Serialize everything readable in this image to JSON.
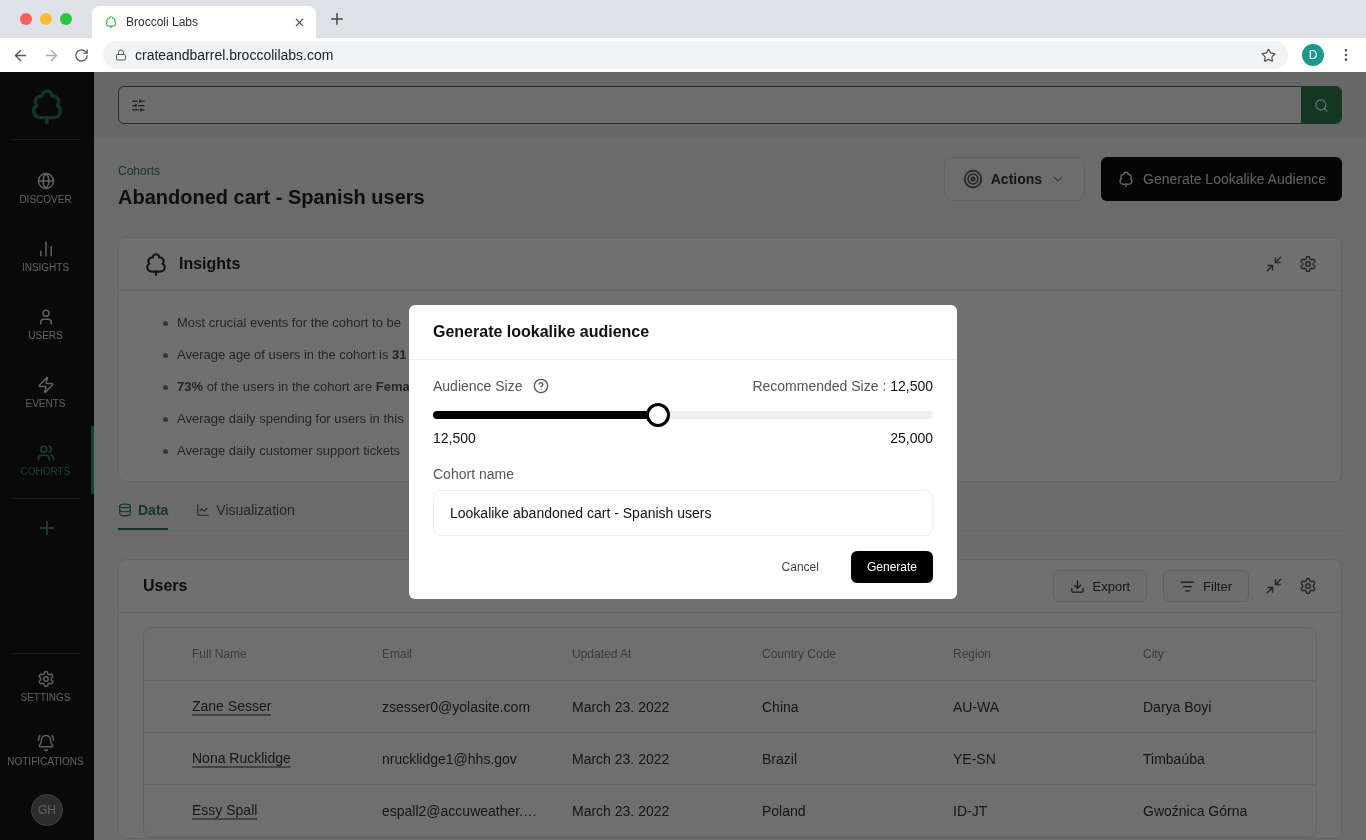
{
  "browser": {
    "tab_title": "Broccoli Labs",
    "url": "crateandbarrel.broccolilabs.com",
    "profile": "D"
  },
  "sidebar": {
    "items": [
      {
        "kind": "discover",
        "label": "DISCOVER",
        "selected": false
      },
      {
        "kind": "insights",
        "label": "INSIGHTS",
        "selected": false
      },
      {
        "kind": "users",
        "label": "USERS",
        "selected": false
      },
      {
        "kind": "events",
        "label": "EVENTS",
        "selected": false
      },
      {
        "kind": "cohorts",
        "label": "COHORTS",
        "selected": true
      }
    ],
    "bottom_items": [
      {
        "kind": "settings",
        "label": "SETTINGS"
      },
      {
        "kind": "notifications",
        "label": "NOTIFICATIONS"
      }
    ],
    "avatar": "GH"
  },
  "breadcrumb": "Cohorts",
  "title": "Abandoned cart - Spanish users",
  "actions_button": "Actions",
  "generate_button": "Generate Lookalike Audience",
  "insights": {
    "title": "Insights",
    "items": [
      "Most crucial events for the cohort to be",
      "Average age of users in the cohort is **31**",
      "**73%** of the users in the cohort are **Fema**",
      "Average daily spending for users in this",
      "Average daily customer support tickets"
    ]
  },
  "tabs": [
    {
      "kind": "data",
      "label": "Data",
      "selected": true
    },
    {
      "kind": "visualization",
      "label": "Visualization",
      "selected": false
    }
  ],
  "users": {
    "title": "Users",
    "export_button": "Export",
    "filter_button": "Filter",
    "columns": [
      "Full Name",
      "Email",
      "Updated At",
      "Country Code",
      "Region",
      "City"
    ],
    "rows": [
      [
        "Zane Sesser",
        "zsesser0@yolasite.com",
        "March 23. 2022",
        "China",
        "AU-WA",
        "Darya Boyi"
      ],
      [
        "Nona Rucklidge",
        "nrucklidge1@hhs.gov",
        "March 23. 2022",
        "Brazil",
        "YE-SN",
        "Timbaúba"
      ],
      [
        "Essy Spall",
        "espall2@accuweather.…",
        "March 23. 2022",
        "Poland",
        "ID-JT",
        "Gwoźnica Górna"
      ]
    ]
  },
  "modal": {
    "title": "Generate lookalike audience",
    "audience_label": "Audience Size",
    "recommended_label": "Recommended Size :",
    "recommended_value": "12,500",
    "slider": {
      "level": 0.45,
      "min": "12,500",
      "max": "25,000"
    },
    "cohort_label": "Cohort name",
    "cohort_value": "Lookalike abandoned cart - Spanish users",
    "cancel_button": "Cancel",
    "generate_button": "Generate"
  }
}
